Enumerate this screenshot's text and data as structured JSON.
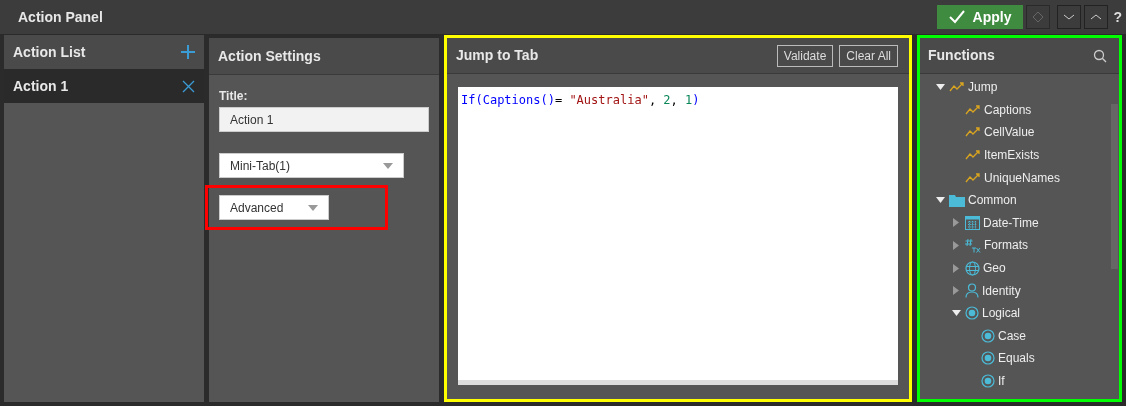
{
  "window": {
    "title": "Action Panel"
  },
  "toolbar": {
    "apply": "Apply",
    "help": "?"
  },
  "action_list": {
    "title": "Action List",
    "items": [
      {
        "label": "Action 1",
        "selected": true
      }
    ]
  },
  "action_settings": {
    "title": "Action Settings",
    "title_label": "Title:",
    "title_value": "Action 1",
    "dropdowns": [
      {
        "value": "Mini-Tab(1)",
        "highlighted": false
      },
      {
        "value": "Advanced",
        "highlighted": true
      }
    ]
  },
  "editor": {
    "title": "Jump to Tab",
    "highlighted": true,
    "buttons": [
      "Validate",
      "Clear All"
    ],
    "code": [
      {
        "kind": "keyword",
        "text": "If("
      },
      {
        "kind": "keyword",
        "text": "Captions()"
      },
      {
        "kind": "punct",
        "text": "= "
      },
      {
        "kind": "string",
        "text": "\"Australia\""
      },
      {
        "kind": "punct",
        "text": ", "
      },
      {
        "kind": "number",
        "text": "2"
      },
      {
        "kind": "punct",
        "text": ", "
      },
      {
        "kind": "number",
        "text": "1"
      },
      {
        "kind": "keyword",
        "text": ")"
      }
    ]
  },
  "functions": {
    "title": "Functions",
    "highlighted": true,
    "tree": [
      {
        "label": "Jump",
        "kind": "trend",
        "expanded": true,
        "children": [
          {
            "label": "Captions",
            "kind": "trend"
          },
          {
            "label": "CellValue",
            "kind": "trend"
          },
          {
            "label": "ItemExists",
            "kind": "trend"
          },
          {
            "label": "UniqueNames",
            "kind": "trend"
          }
        ]
      },
      {
        "label": "Common",
        "kind": "folder",
        "expanded": true,
        "children": [
          {
            "label": "Date-Time",
            "kind": "calendar",
            "expanded": false
          },
          {
            "label": "Formats",
            "kind": "hash",
            "expanded": false
          },
          {
            "label": "Geo",
            "kind": "globe",
            "expanded": false
          },
          {
            "label": "Identity",
            "kind": "person",
            "expanded": false
          },
          {
            "label": "Logical",
            "kind": "radio",
            "expanded": true,
            "children": [
              {
                "label": "Case",
                "kind": "radio"
              },
              {
                "label": "Equals",
                "kind": "radio"
              },
              {
                "label": "If",
                "kind": "radio"
              }
            ]
          }
        ]
      }
    ]
  }
}
